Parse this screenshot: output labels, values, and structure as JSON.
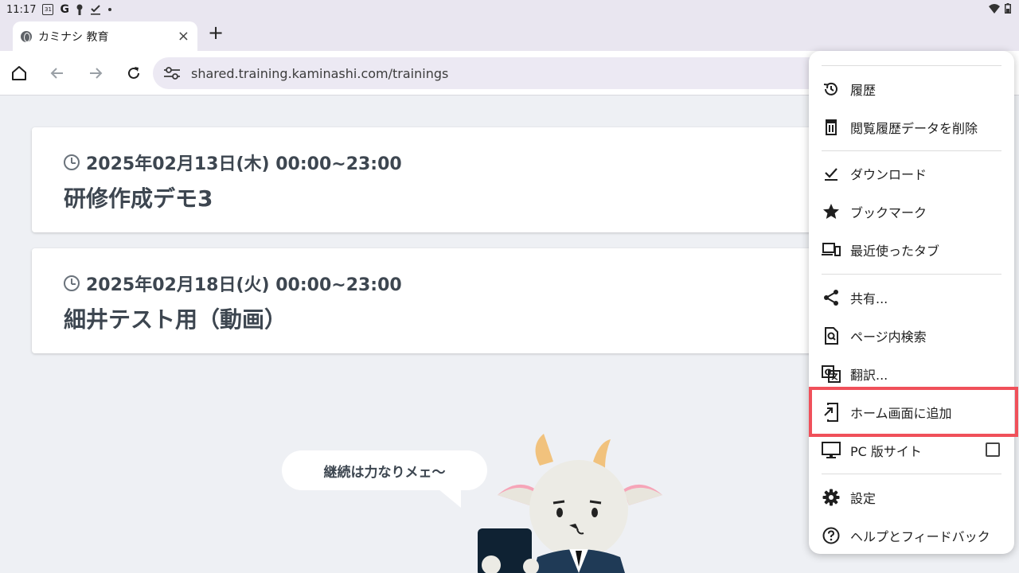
{
  "status_bar": {
    "time": "11:17",
    "calendar_day": "31",
    "g_letter": "G"
  },
  "tab": {
    "title": "カミナシ 教育",
    "close": "×",
    "new_tab": "+"
  },
  "toolbar": {
    "url": "shared.training.kaminashi.com/trainings"
  },
  "trainings": [
    {
      "when": "2025年02月13日(木) 00:00~23:00",
      "title": "研修作成デモ3"
    },
    {
      "when": "2025年02月18日(火) 00:00~23:00",
      "title": "細井テスト用（動画）"
    }
  ],
  "bubble": {
    "text": "継続は力なりメェ〜"
  },
  "menu": {
    "items": [
      {
        "label": "履歴",
        "icon": "history-icon"
      },
      {
        "label": "閲覧履歴データを削除",
        "icon": "trash-icon"
      },
      {
        "label": "ダウンロード",
        "icon": "download-done-icon"
      },
      {
        "label": "ブックマーク",
        "icon": "star-icon"
      },
      {
        "label": "最近使ったタブ",
        "icon": "devices-icon"
      },
      {
        "label": "共有...",
        "icon": "share-icon"
      },
      {
        "label": "ページ内検索",
        "icon": "find-in-page-icon"
      },
      {
        "label": "翻訳...",
        "icon": "translate-icon"
      },
      {
        "label": "ホーム画面に追加",
        "icon": "add-to-home-icon"
      },
      {
        "label": "PC 版サイト",
        "icon": "desktop-icon"
      },
      {
        "label": "設定",
        "icon": "gear-icon"
      },
      {
        "label": "ヘルプとフィードバック",
        "icon": "help-icon"
      }
    ]
  },
  "colors": {
    "highlight": "#f0505a",
    "text_dark": "#3d4650",
    "page_bg": "#eef0f4"
  }
}
